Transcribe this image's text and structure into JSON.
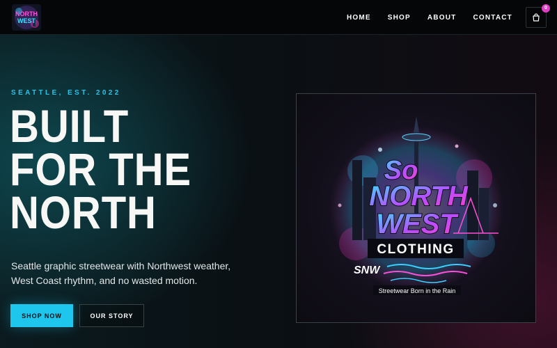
{
  "brand": {
    "logo_text_line1": "NORTH",
    "logo_text_line2": "WEST"
  },
  "nav": {
    "items": [
      "HOME",
      "SHOP",
      "ABOUT",
      "CONTACT"
    ],
    "cart_count": "0"
  },
  "hero": {
    "eyebrow": "SEATTLE, EST. 2022",
    "headline_lines": [
      "BUILT",
      "FOR THE",
      "NORTH"
    ],
    "description": "Seattle graphic streetwear with Northwest weather, West Coast rhythm, and no wasted motion.",
    "primary_button": "SHOP NOW",
    "secondary_button": "OUR STORY"
  },
  "graphic": {
    "line_so": "So",
    "line_north": "NORTH",
    "line_west": "WEST",
    "line_clothing": "CLOTHING",
    "monogram": "SNW",
    "tagline": "Streetwear Born in the Rain"
  },
  "colors": {
    "accent": "#1ec6ee",
    "badge": "#e03cc4",
    "background": "#07090b"
  }
}
